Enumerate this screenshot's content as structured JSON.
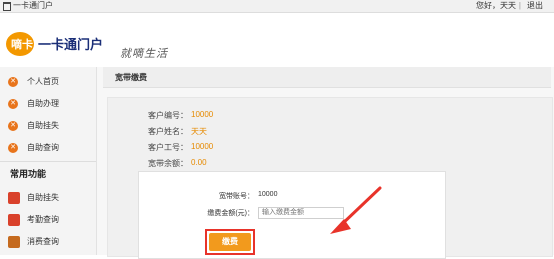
{
  "topbar": {
    "home_label": "一卡通门户",
    "welcome": "您好，天天",
    "logout": "退出"
  },
  "header": {
    "brand_logo_text": "一卡通门户",
    "logo_badge": "嘀卡",
    "slogan": "就嘀生活"
  },
  "sidebar": {
    "items": [
      {
        "label": "个人首页"
      },
      {
        "label": "自助办理"
      },
      {
        "label": "自助挂失"
      },
      {
        "label": "自助查询"
      }
    ],
    "section_title": "常用功能",
    "common": [
      {
        "label": "自助挂失"
      },
      {
        "label": "考勤查询"
      },
      {
        "label": "消费查询"
      }
    ]
  },
  "main": {
    "title": "宽带缴费",
    "info": [
      {
        "label": "客户编号：",
        "value": "10000"
      },
      {
        "label": "客户姓名：",
        "value": "天天"
      },
      {
        "label": "客户工号：",
        "value": "10000"
      },
      {
        "label": "宽带余额：",
        "value": "0.00"
      }
    ],
    "form": {
      "account_label": "宽带账号：",
      "account_value": "10000",
      "amount_label": "缴费金额(元)：",
      "amount_placeholder": "输入缴费金额",
      "pay_button": "缴费"
    }
  },
  "colors": {
    "accent": "#f39800",
    "highlight_red": "#e8332a",
    "value_orange": "#e68a00"
  }
}
